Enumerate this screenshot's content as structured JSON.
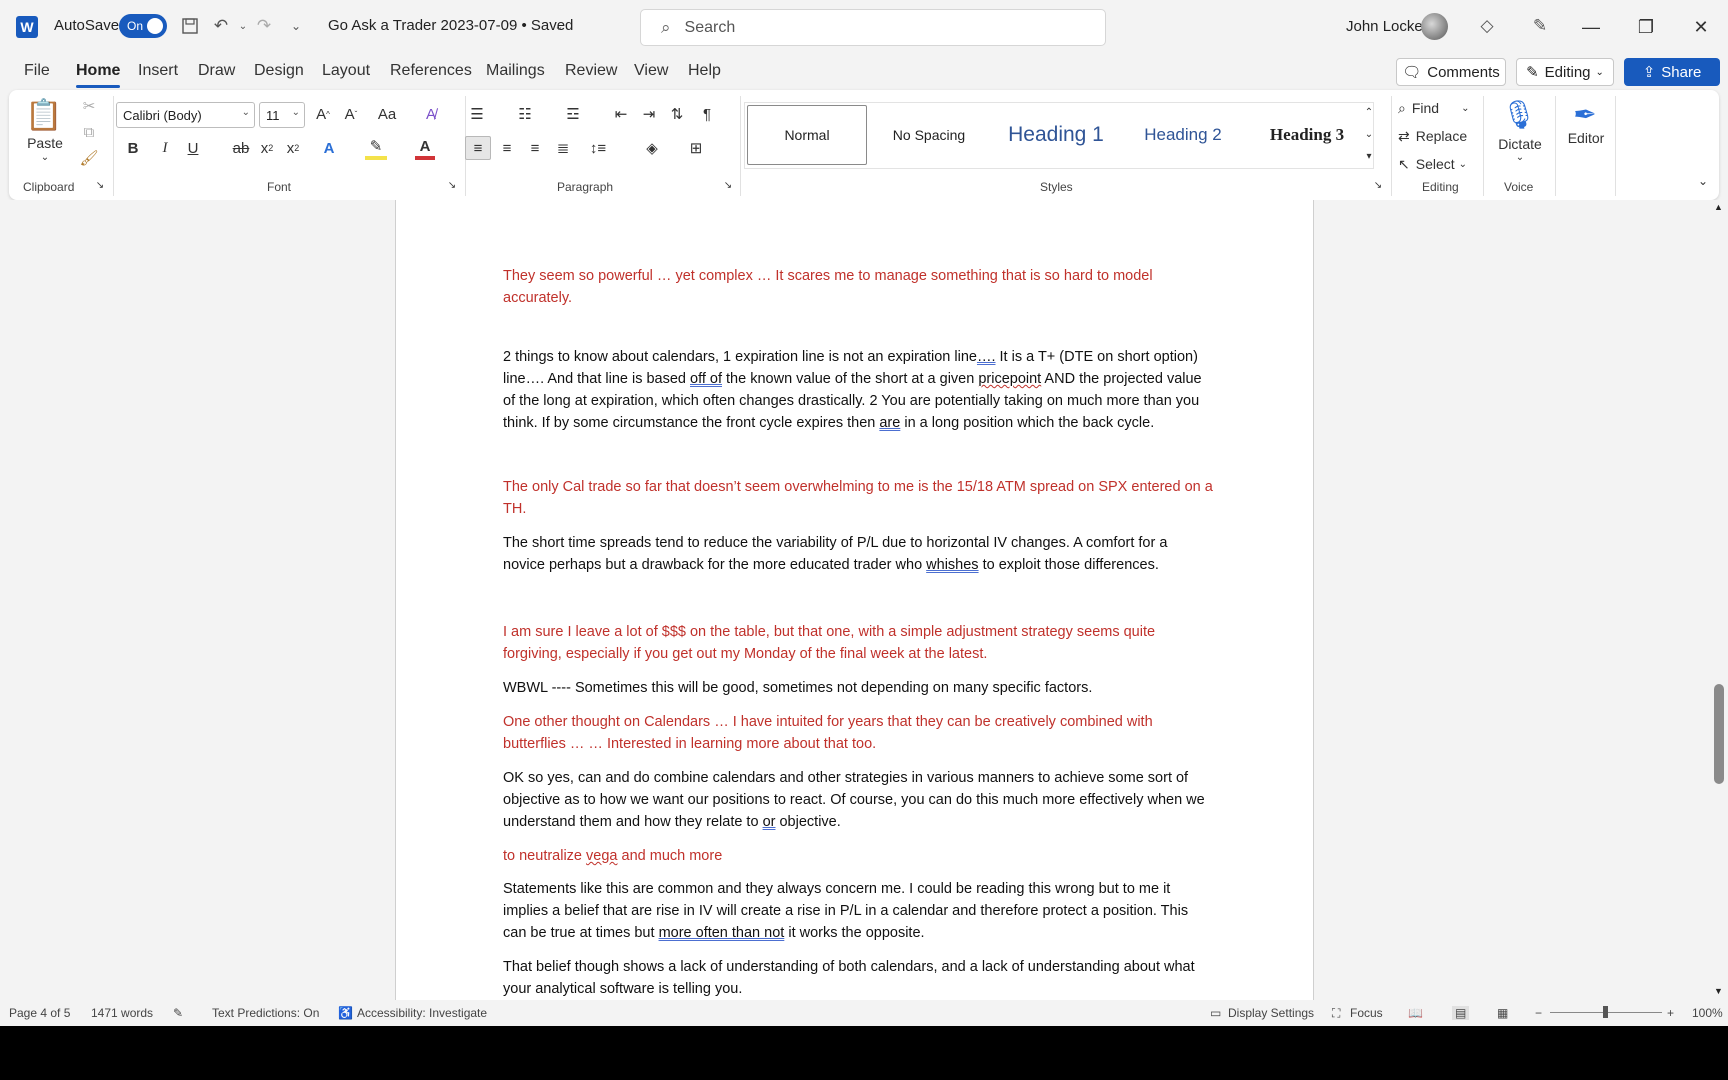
{
  "titlebar": {
    "autosave_label": "AutoSave",
    "autosave_state": "On",
    "doc_title": "Go Ask a Trader 2023-07-09 • Saved",
    "search_placeholder": "Search",
    "user_name": "John Locke"
  },
  "menu": {
    "tabs": [
      "File",
      "Home",
      "Insert",
      "Draw",
      "Design",
      "Layout",
      "References",
      "Mailings",
      "Review",
      "View",
      "Help"
    ],
    "comments_label": "Comments",
    "editing_label": "Editing",
    "share_label": "Share"
  },
  "ribbon": {
    "clipboard": {
      "paste_label": "Paste",
      "group_label": "Clipboard"
    },
    "font": {
      "font_name": "Calibri (Body)",
      "font_size": "11",
      "group_label": "Font"
    },
    "paragraph": {
      "group_label": "Paragraph"
    },
    "styles": {
      "group_label": "Styles",
      "items": [
        "Normal",
        "No Spacing",
        "Heading 1",
        "Heading 2",
        "Heading 3"
      ]
    },
    "editing": {
      "find_label": "Find",
      "replace_label": "Replace",
      "select_label": "Select",
      "group_label": "Editing"
    },
    "voice": {
      "dictate_label": "Dictate",
      "group_label": "Voice"
    },
    "editor": {
      "editor_label": "Editor"
    }
  },
  "document": {
    "p1": "They seem so powerful … yet complex … It scares me to manage something that is so hard to model accurately.",
    "p2a": "2 things to know about calendars, 1 expiration line is not an expiration line",
    "p2b": "….",
    "p2c": " It is a T+ (DTE on short option) line…. And that line is based ",
    "p2d": "off of",
    "p2e": " the known value of the short at a given ",
    "p2f": "pricepoint",
    "p2g": " AND the projected value of the long at expiration, which often changes drastically.   2 You are potentially taking on much more than you think. If by some circumstance the front cycle expires then ",
    "p2h": "are",
    "p2i": " in a long position which the back cycle.",
    "p3": "The only Cal trade so far that doesn’t seem overwhelming to me is the 15/18 ATM spread on SPX entered on a TH.",
    "p4a": "The short time spreads tend to reduce the variability of P/L due to horizontal IV changes. A comfort for a novice perhaps but a drawback for the more educated trader who ",
    "p4b": "whishes",
    "p4c": " to exploit those differences.",
    "p5": "I am sure I leave a lot of $$$ on the table, but that one, with a simple adjustment strategy seems quite forgiving, especially if you get out my Monday of the final week at the latest.",
    "p6": "WBWL ---- Sometimes this will be good, sometimes not depending on many specific factors.",
    "p7": "One other thought on Calendars … I have intuited for years that they can be creatively combined with butterflies … … Interested in learning more about that too.",
    "p8a": "OK so yes, can and do combine calendars and other strategies in various manners to achieve some sort of objective as to how we want our positions to react. Of course, you can do this much more effectively when we understand them and how they relate to ",
    "p8b": "or",
    "p8c": " objective.",
    "p9a": "to neutralize ",
    "p9b": "vega",
    "p9c": " and much more",
    "p10a": "Statements like this are common and they always concern me. I could be reading this wrong but to me it implies a belief that are rise in IV will create a rise in P/L in a calendar and therefore protect a position. This can be true at times but ",
    "p10b": "more often than not",
    "p10c": " it works the opposite.",
    "p11": "That belief though shows a lack of understanding of both calendars, and a lack of understanding about what your analytical software is telling you."
  },
  "status": {
    "page": "Page 4 of 5",
    "words": "1471 words",
    "predictions": "Text Predictions: On",
    "accessibility": "Accessibility: Investigate",
    "display_settings": "Display Settings",
    "focus": "Focus",
    "zoom": "100%"
  },
  "colors": {
    "accent": "#185abd",
    "comment_text": "#c0312b"
  }
}
